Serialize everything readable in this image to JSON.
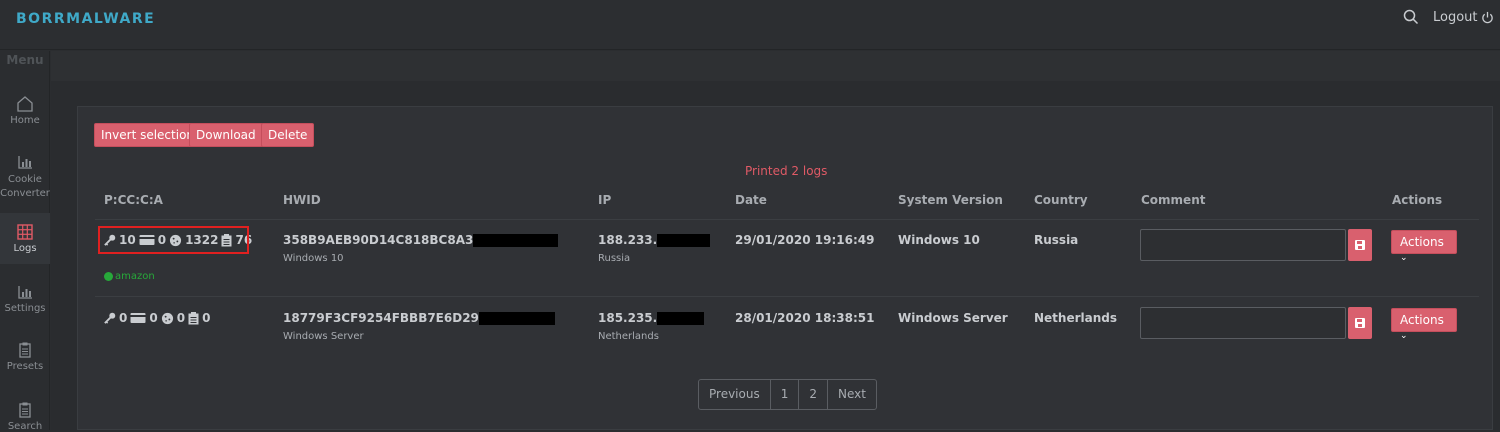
{
  "brand": "BORRMALWARE",
  "topbar": {
    "logout_label": "Logout"
  },
  "sidebar": {
    "menu_label": "Menu",
    "items": [
      {
        "label": "Home",
        "icon": "home-icon"
      },
      {
        "label": "Cookie Converter",
        "icon": "bar-chart-icon"
      },
      {
        "label": "Logs",
        "icon": "grid-icon"
      },
      {
        "label": "Settings",
        "icon": "bar-chart-icon"
      },
      {
        "label": "Presets",
        "icon": "clipboard-icon"
      },
      {
        "label": "Search",
        "icon": "clipboard-icon"
      }
    ]
  },
  "toolbar": {
    "invert_label": "Invert selection",
    "download_label": "Download",
    "delete_label": "Delete"
  },
  "status_text": "Printed 2 logs",
  "table": {
    "headers": [
      "P:CC:C:A",
      "HWID",
      "IP",
      "Date",
      "System Version",
      "Country",
      "Comment",
      "Actions"
    ],
    "rows": [
      {
        "passwords": "10",
        "cards": "0",
        "cookies": "1322",
        "autofill": "76",
        "tag": "amazon",
        "hwid": "358B9AEB90D14C818BC8A3",
        "hwid_sub": "Windows 10",
        "ip": "188.233.",
        "ip_sub": "Russia",
        "date": "29/01/2020 19:16:49",
        "system": "Windows 10",
        "country": "Russia",
        "comment": "",
        "actions_label": "Actions"
      },
      {
        "passwords": "0",
        "cards": "0",
        "cookies": "0",
        "autofill": "0",
        "hwid": "18779F3CF9254FBBB7E6D29",
        "hwid_sub": "Windows Server",
        "ip": "185.235.",
        "ip_sub": "Netherlands",
        "date": "28/01/2020 18:38:51",
        "system": "Windows Server",
        "country": "Netherlands",
        "comment": "",
        "actions_label": "Actions"
      }
    ]
  },
  "pagination": {
    "previous": "Previous",
    "pages": [
      "1",
      "2"
    ],
    "next": "Next"
  },
  "colors": {
    "accent": "#d9606e",
    "brand": "#3fa9c8",
    "tag": "#27a83a",
    "highlight": "#e02020"
  }
}
